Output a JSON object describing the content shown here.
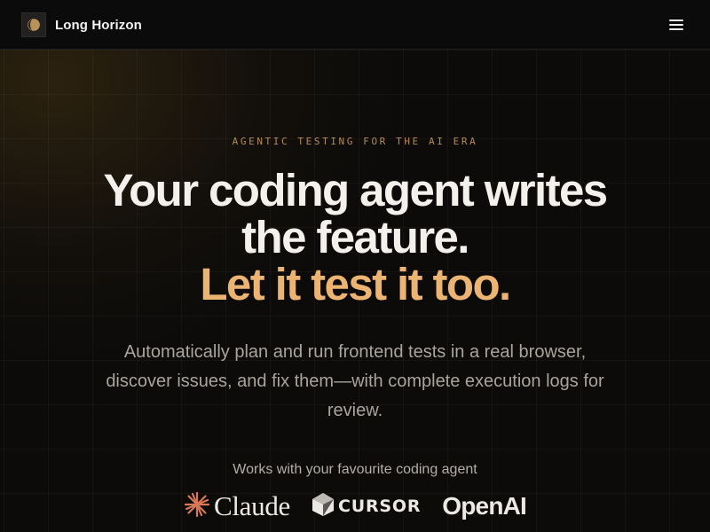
{
  "header": {
    "brand_name": "Long Horizon",
    "logo_icon": "half-moon-logo-icon",
    "menu_icon": "hamburger-menu-icon"
  },
  "hero": {
    "eyebrow": "AGENTIC TESTING FOR THE AI ERA",
    "headline_line1": "Your coding agent writes",
    "headline_line2": "the feature.",
    "headline_line3": "Let it test it too.",
    "subtitle": "Automatically plan and run frontend tests in a real browser, discover issues, and fix them—with complete execution logs for review.",
    "works_with_label": "Works with your favourite coding agent"
  },
  "partners": [
    {
      "name": "Claude",
      "icon": "claude-starburst-icon"
    },
    {
      "name": "CURSOR",
      "icon": "cursor-cube-icon"
    },
    {
      "name": "OpenAI",
      "icon": ""
    }
  ],
  "colors": {
    "background": "#0c0b0a",
    "accent": "#ebb472",
    "eyebrow": "#b58a56",
    "claude_orange": "#d97757",
    "text_primary": "#f4f1ec",
    "text_muted": "#a9a49d"
  }
}
